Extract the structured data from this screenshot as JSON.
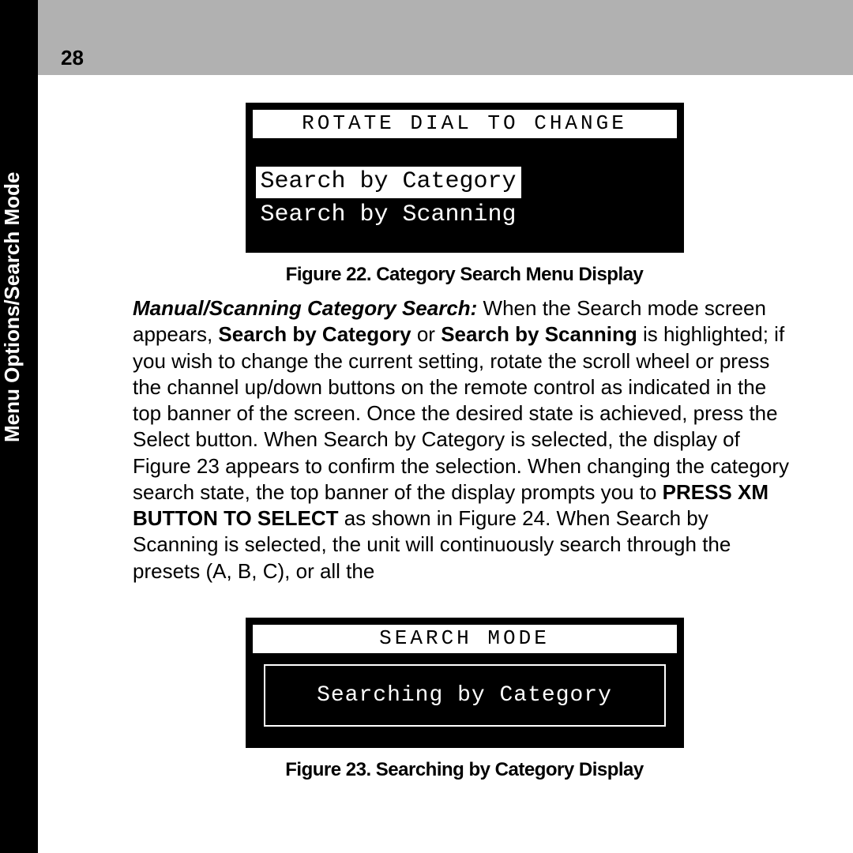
{
  "sideLabel": "Menu Options/Search Mode",
  "pageNumber": "28",
  "figure22": {
    "banner": "ROTATE DIAL TO CHANGE",
    "optionSelected": "Search by Category",
    "optionUnselected": "Search by Scanning",
    "caption": "Figure 22. Category Search Menu Display"
  },
  "paragraph": {
    "lead": "Manual/Scanning Category Search:",
    "t1": " When the Search mode screen appears, ",
    "b1": "Search by Category",
    "t2": " or ",
    "b2": "Search by Scanning",
    "t3": " is highlighted; if you wish to change the current setting, rotate the scroll wheel or press the channel up/down buttons on the remote control as indicated in the top banner of the screen. Once the desired state is achieved, press the Select button. When Search by Category is selected, the display of Figure 23 appears to confirm the selection. When changing the category search state, the top banner of the display prompts you to ",
    "b3": "PRESS XM BUTTON TO SELECT",
    "t4": " as shown in Figure 24. When Search by Scanning is selected, the unit will continuously search through the presets (A, B, C), or all the"
  },
  "figure23": {
    "banner": "SEARCH MODE",
    "status": "Searching by Category",
    "caption": "Figure 23. Searching by Category Display"
  }
}
